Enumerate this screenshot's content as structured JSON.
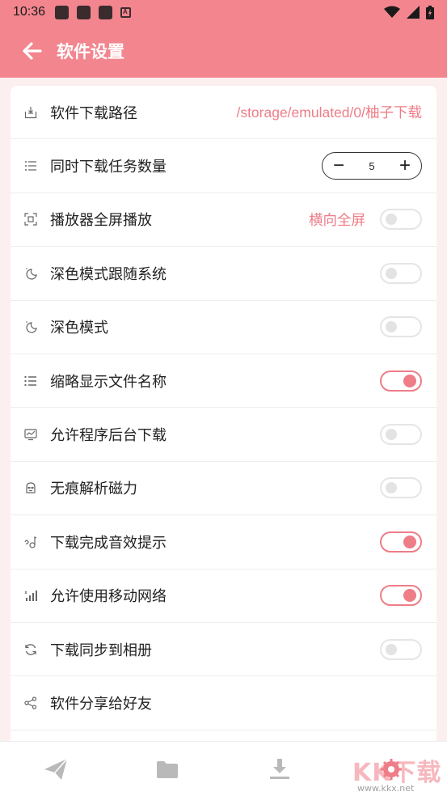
{
  "status_bar": {
    "time": "10:36"
  },
  "header": {
    "title": "软件设置"
  },
  "settings": [
    {
      "label": "软件下载路径",
      "value": "/storage/emulated/0/柚子下载",
      "icon": "download-box-icon"
    },
    {
      "label": "同时下载任务数量",
      "stepper": {
        "minus": "−",
        "value": "5",
        "plus": "+"
      },
      "icon": "list-icon"
    },
    {
      "label": "播放器全屏播放",
      "value": "横向全屏",
      "toggle": false,
      "icon": "fullscreen-icon"
    },
    {
      "label": "深色模式跟随系统",
      "toggle": false,
      "icon": "moon-icon"
    },
    {
      "label": "深色模式",
      "toggle": false,
      "icon": "moon-icon"
    },
    {
      "label": "缩略显示文件名称",
      "toggle": true,
      "icon": "list-bullets-icon"
    },
    {
      "label": "允许程序后台下载",
      "toggle": false,
      "icon": "monitor-icon"
    },
    {
      "label": "无痕解析磁力",
      "toggle": false,
      "icon": "incognito-icon"
    },
    {
      "label": "下载完成音效提示",
      "toggle": true,
      "icon": "music-note-icon"
    },
    {
      "label": "允许使用移动网络",
      "toggle": true,
      "icon": "signal-icon"
    },
    {
      "label": "下载同步到相册",
      "toggle": false,
      "icon": "sync-icon"
    },
    {
      "label": "软件分享给好友",
      "icon": "share-icon"
    }
  ],
  "bottom_nav": [
    "send-icon",
    "folder-icon",
    "download-icon",
    "settings-icon"
  ],
  "watermark": {
    "text": "KK下载",
    "url": "www.kkx.net"
  },
  "colors": {
    "accent": "#ee7d88",
    "header": "#f2858e",
    "background": "#fbeff0"
  }
}
